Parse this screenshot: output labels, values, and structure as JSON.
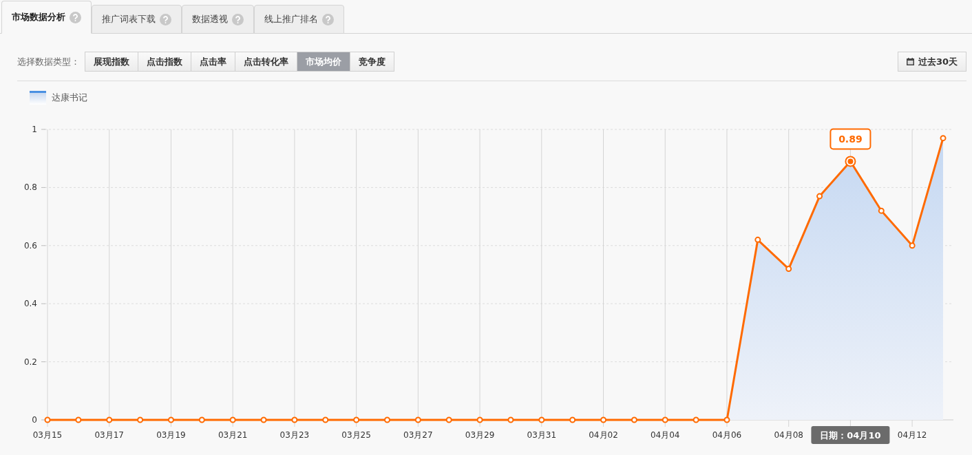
{
  "tabs": [
    {
      "label": "市场数据分析",
      "selected": true
    },
    {
      "label": "推广词表下载",
      "selected": false
    },
    {
      "label": "数据透视",
      "selected": false
    },
    {
      "label": "线上推广排名",
      "selected": false
    }
  ],
  "toolbar": {
    "label": "选择数据类型：",
    "types": [
      {
        "label": "展现指数",
        "selected": false
      },
      {
        "label": "点击指数",
        "selected": false
      },
      {
        "label": "点击率",
        "selected": false
      },
      {
        "label": "点击转化率",
        "selected": false
      },
      {
        "label": "市场均价",
        "selected": true
      },
      {
        "label": "竞争度",
        "selected": false
      }
    ],
    "period_button": "过去30天"
  },
  "chart": {
    "chart_data": {
      "type": "area",
      "categories": [
        "03月15",
        null,
        "03月17",
        null,
        "03月19",
        null,
        "03月21",
        null,
        "03月23",
        null,
        "03月25",
        null,
        "03月27",
        null,
        "03月29",
        null,
        "03月31",
        null,
        "04月02",
        null,
        "04月04",
        null,
        "04月06",
        null,
        "04月08",
        null,
        null,
        null,
        "04月12",
        null
      ],
      "series": [
        {
          "name": "达康书记",
          "color": "#ff6a00",
          "values": [
            0,
            0,
            0,
            0,
            0,
            0,
            0,
            0,
            0,
            0,
            0,
            0,
            0,
            0,
            0,
            0,
            0,
            0,
            0,
            0,
            0,
            0,
            0,
            0.62,
            0.52,
            0.77,
            0.89,
            0.72,
            0.6,
            0.97
          ]
        }
      ],
      "ylim": [
        0,
        1
      ],
      "grid": true,
      "yticks": [
        {
          "value": 0,
          "label": "0"
        },
        {
          "value": 0.2,
          "label": "0.2"
        },
        {
          "value": 0.4,
          "label": "0.4"
        },
        {
          "value": 0.6,
          "label": "0.6"
        },
        {
          "value": 0.8,
          "label": "0.8"
        },
        {
          "value": 1,
          "label": "1"
        }
      ]
    },
    "tooltip": {
      "value_label": "0.89",
      "date_label": "日期：04月10"
    }
  }
}
